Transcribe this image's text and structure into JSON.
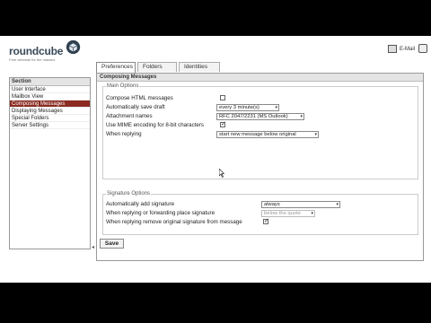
{
  "app": {
    "logo_text": "roundcube",
    "logo_tagline": "Free webmail for the masses",
    "mail_link": "E-Mail"
  },
  "tabs": [
    {
      "label": "Preferences",
      "active": true
    },
    {
      "label": "Folders",
      "active": false
    },
    {
      "label": "Identities",
      "active": false
    }
  ],
  "sections": {
    "header": "Section",
    "items": [
      {
        "label": "User Interface",
        "selected": false
      },
      {
        "label": "Mailbox View",
        "selected": false
      },
      {
        "label": "Composing Messages",
        "selected": true
      },
      {
        "label": "Displaying Messages",
        "selected": false
      },
      {
        "label": "Special Folders",
        "selected": false
      },
      {
        "label": "Server Settings",
        "selected": false
      }
    ],
    "splitter_glyph": "◂"
  },
  "panel": {
    "title": "Composing Messages",
    "main": {
      "legend": "Main Options",
      "compose_html": {
        "label": "Compose HTML messages",
        "checked": false
      },
      "autosave": {
        "label": "Automatically save draft",
        "value": "every 3 minute(s)"
      },
      "attachment_names": {
        "label": "Attachment names",
        "value": "RFC 2047/2231 (MS Outlook)"
      },
      "mime_8bit": {
        "label": "Use MIME encoding for 8-bit characters",
        "checked": true
      },
      "replying": {
        "label": "When replying",
        "value": "start new message below original"
      }
    },
    "signature": {
      "legend": "Signature Options",
      "auto_add": {
        "label": "Automatically add signature",
        "value": "always"
      },
      "place": {
        "label": "When replying or forwarding place signature",
        "value": "below the quote"
      },
      "remove_orig": {
        "label": "When replying remove original signature from message",
        "checked": true
      }
    }
  },
  "save_label": "Save",
  "colors": {
    "selected_row": "#8a2c22",
    "header_bg": "#e4e4e4",
    "border": "#999999"
  }
}
